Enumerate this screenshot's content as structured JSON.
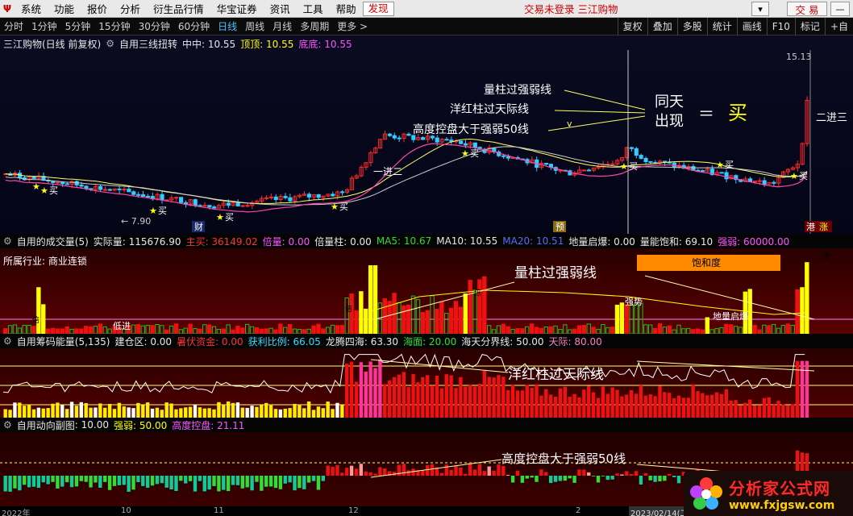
{
  "menubar": {
    "items": [
      "系统",
      "功能",
      "报价",
      "分析",
      "衍生品行情",
      "华宝证券",
      "资讯",
      "工具",
      "帮助"
    ],
    "active": "发现",
    "status": "交易未登录  三江购物",
    "trade": "交 易"
  },
  "toolbar": {
    "periods": [
      "分时",
      "1分钟",
      "5分钟",
      "15分钟",
      "30分钟",
      "60分钟",
      "日线",
      "周线",
      "月线",
      "多周期",
      "更多 >"
    ],
    "selected": "日线",
    "right": [
      "复权",
      "叠加",
      "多股",
      "统计",
      "画线",
      "F10",
      "标记",
      "+自"
    ]
  },
  "main_chart": {
    "title": "三江购物(日线 前复权)",
    "indicator": "自用三线扭转",
    "zz_label": "中中: 10.55",
    "dd_label": "顶顶: 10.55",
    "db_label": "底底: 10.55",
    "high_price": "15.13",
    "low_price": "7.90",
    "annotations": {
      "l1": "量柱过强弱线",
      "l2": "洋红柱过天际线",
      "l3": "高度控盘大于强弱50线",
      "same_day": "同天",
      "appear": "出现",
      "eq": "＝",
      "buy": "买",
      "erjinsan": "二进三",
      "yijiner": "一进二"
    },
    "buy_label": "买",
    "markers": {
      "cai": "财",
      "yu": "预",
      "gang": "港",
      "zhang": "涨"
    }
  },
  "vol_panel": {
    "name": "自用的成交量(5)",
    "actual": "实际量: 115676.90",
    "zhumai": "主买: 36149.02",
    "beiliang": "倍量: 0.00",
    "beiliangzhu": "倍量柱: 0.00",
    "ma5": "MA5: 10.67",
    "ma10": "MA10: 10.55",
    "ma20": "MA20: 10.51",
    "dlqb": "地量启爆: 0.00",
    "lnbh": "量能饱和: 69.10",
    "qr": "强弱: 60000.00",
    "industry": "所属行业: 商业连锁",
    "anno": "量柱过强弱线",
    "baohedu": "饱和度",
    "qiangshi": "强势",
    "dlqb_mark": "地量启爆",
    "dijin": "低进",
    "bei": "倍"
  },
  "chip_panel": {
    "name": "自用筹码能量(5,135)",
    "jcq": "建仓区: 0.00",
    "zfzj": "暑伏资金: 0.00",
    "hlbl": "获利比例: 66.05",
    "ltsh": "龙腾四海: 63.30",
    "hm": "海面: 20.00",
    "htfjx": "海天分界线: 50.00",
    "tj": "天际: 80.00",
    "anno": "洋红柱过天际线"
  },
  "flow_panel": {
    "name": "自用动向副图",
    "val": ": 10.00",
    "qr": "强弱: 50.00",
    "gdkp": "高度控盘: 21.11",
    "anno": "高度控盘大于强弱50线"
  },
  "time_axis": [
    "2022年",
    "10",
    "11",
    "12",
    "2",
    "2023/02/14(二)"
  ],
  "watermark": {
    "cn": "分析家公式网",
    "url": "www.fxjgsw.com"
  },
  "colors": {
    "up": "#ff2a2a",
    "down": "#33ccff",
    "volume_ma": "#ffff00",
    "accent": "#ff5555"
  }
}
